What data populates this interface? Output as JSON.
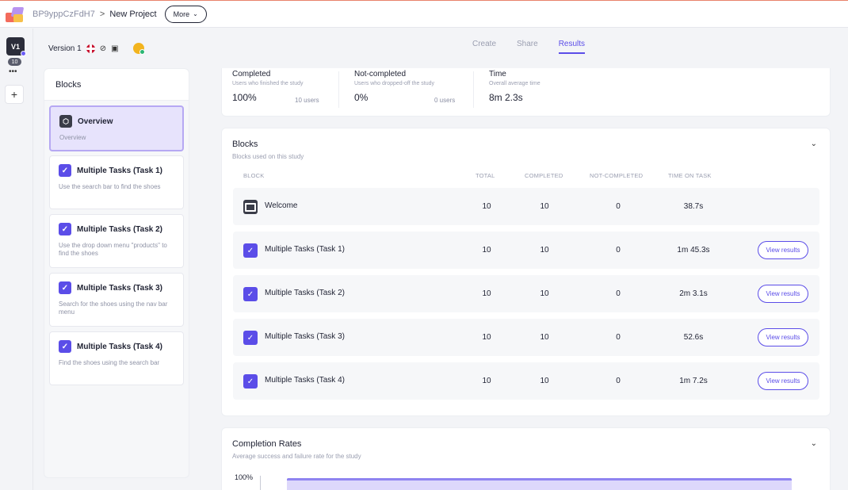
{
  "topbar": {
    "project_id": "BP9yppCzFdH7",
    "separator": ">",
    "project_name": "New Project",
    "more_label": "More"
  },
  "rail": {
    "version_badge": "V1",
    "count": "10",
    "dots": "•••",
    "add": "+"
  },
  "version": {
    "label": "Version 1"
  },
  "tabs": [
    {
      "label": "Create",
      "active": false
    },
    {
      "label": "Share",
      "active": false
    },
    {
      "label": "Results",
      "active": true
    }
  ],
  "sidebar": {
    "title": "Blocks",
    "items": [
      {
        "title": "Overview",
        "desc": "Overview"
      },
      {
        "title": "Multiple Tasks (Task 1)",
        "desc": "Use the search bar to find the shoes"
      },
      {
        "title": "Multiple Tasks (Task 2)",
        "desc": "Use the drop down menu \"products\" to find the shoes"
      },
      {
        "title": "Multiple Tasks (Task 3)",
        "desc": "Search for the shoes using the nav bar menu"
      },
      {
        "title": "Multiple Tasks (Task 4)",
        "desc": "Find the shoes using the search bar"
      }
    ]
  },
  "stats": {
    "completed": {
      "label": "Completed",
      "sub": "Users who finished the study",
      "value": "100%",
      "users": "10 users"
    },
    "not_completed": {
      "label": "Not-completed",
      "sub": "Users who dropped-off the study",
      "value": "0%",
      "users": "0 users"
    },
    "time": {
      "label": "Time",
      "sub": "Overall average time",
      "value": "8m 2.3s"
    }
  },
  "blocks_table": {
    "title": "Blocks",
    "subtitle": "Blocks used on this study",
    "headers": [
      "BLOCK",
      "TOTAL",
      "COMPLETED",
      "NOT-COMPLETED",
      "TIME ON TASK"
    ],
    "rows": [
      {
        "name": "Welcome",
        "total": "10",
        "completed": "10",
        "not_completed": "0",
        "time": "38.7s",
        "action": ""
      },
      {
        "name": "Multiple Tasks (Task 1)",
        "total": "10",
        "completed": "10",
        "not_completed": "0",
        "time": "1m 45.3s",
        "action": "View results"
      },
      {
        "name": "Multiple Tasks (Task 2)",
        "total": "10",
        "completed": "10",
        "not_completed": "0",
        "time": "2m 3.1s",
        "action": "View results"
      },
      {
        "name": "Multiple Tasks (Task 3)",
        "total": "10",
        "completed": "10",
        "not_completed": "0",
        "time": "52.6s",
        "action": "View results"
      },
      {
        "name": "Multiple Tasks (Task 4)",
        "total": "10",
        "completed": "10",
        "not_completed": "0",
        "time": "1m 7.2s",
        "action": "View results"
      }
    ]
  },
  "completion_rates": {
    "title": "Completion Rates",
    "subtitle": "Average success and failure rate for the study",
    "y_top_label": "100%"
  },
  "colors": {
    "accent": "#5b4de8",
    "dark": "#1f2233"
  },
  "icons": {
    "chevron": "chevron-down-icon",
    "check": "checkbox-icon",
    "cube": "cube-icon"
  }
}
